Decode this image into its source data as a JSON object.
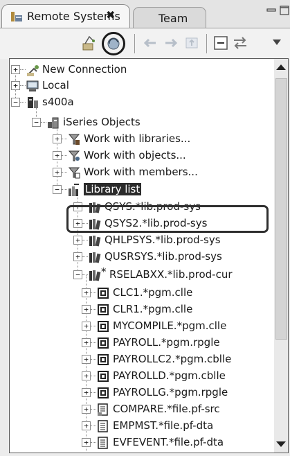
{
  "tabs": {
    "active_label": "Remote Systems",
    "close_glyph": "✖",
    "other_label": "Team"
  },
  "tree": [
    {
      "label": "New Connection",
      "icon": "new-connection-icon",
      "expander": "+"
    },
    {
      "label": "Local",
      "icon": "local-host-icon",
      "expander": "+"
    },
    {
      "label": "s400a",
      "icon": "iseries-system-icon",
      "expander": "−"
    },
    {
      "label": "iSeries Objects",
      "icon": "iseries-objects-icon",
      "expander": "−"
    },
    {
      "label": "Work with libraries...",
      "icon": "library-filter-icon",
      "expander": "+"
    },
    {
      "label": "Work with objects...",
      "icon": "object-filter-icon",
      "expander": "+"
    },
    {
      "label": "Work with members...",
      "icon": "member-filter-icon",
      "expander": "+"
    },
    {
      "label": "Library list",
      "icon": "library-list-icon",
      "expander": "−"
    },
    {
      "label": "QSYS.*lib.prod-sys",
      "icon": "library-icon",
      "expander": "+"
    },
    {
      "label": "QSYS2.*lib.prod-sys",
      "icon": "library-icon",
      "expander": "+"
    },
    {
      "label": "QHLPSYS.*lib.prod-sys",
      "icon": "library-icon",
      "expander": "+"
    },
    {
      "label": "QUSRSYS.*lib.prod-sys",
      "icon": "library-icon",
      "expander": "+"
    },
    {
      "label": "RSELABXX.*lib.prod-cur",
      "icon": "current-library-icon",
      "expander": "−"
    },
    {
      "label": "CLC1.*pgm.clle",
      "icon": "program-icon",
      "expander": "+"
    },
    {
      "label": "CLR1.*pgm.clle",
      "icon": "program-icon",
      "expander": "+"
    },
    {
      "label": "MYCOMPILE.*pgm.clle",
      "icon": "program-icon",
      "expander": "+"
    },
    {
      "label": "PAYROLL.*pgm.rpgle",
      "icon": "program-icon",
      "expander": "+"
    },
    {
      "label": "PAYROLLC2.*pgm.cblle",
      "icon": "program-icon",
      "expander": "+"
    },
    {
      "label": "PAYROLLD.*pgm.cblle",
      "icon": "program-icon",
      "expander": "+"
    },
    {
      "label": "PAYROLLG.*pgm.rpgle",
      "icon": "program-icon",
      "expander": "+"
    },
    {
      "label": "COMPARE.*file.pf-src",
      "icon": "source-file-icon",
      "expander": "+"
    },
    {
      "label": "EMPMST.*file.pf-dta",
      "icon": "data-file-icon",
      "expander": "+"
    },
    {
      "label": "EVFEVENT.*file.pf-dta",
      "icon": "data-file-icon",
      "expander": "+"
    }
  ],
  "current_library_marker": "*"
}
